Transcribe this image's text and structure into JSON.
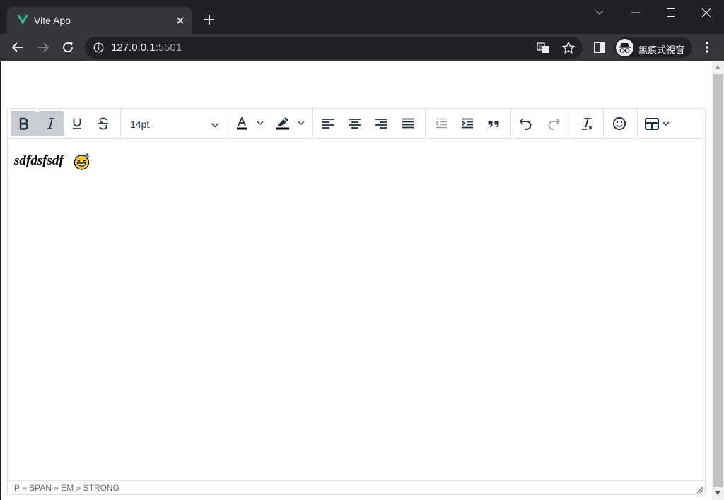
{
  "browser": {
    "tab_title": "Vite App",
    "url_host": "127.0.0.1",
    "url_port": ":5501",
    "incognito_label": "無痕式視窗"
  },
  "editor": {
    "toolbar": {
      "font_size": "14pt",
      "active_buttons": [
        "bold",
        "italic"
      ]
    },
    "content_text": "sdfdsfsdf",
    "emoji": "grinning-face-with-sweat",
    "status_path": "P » SPAN » EM » STRONG"
  },
  "colors": {
    "chrome_dark": "#202124",
    "chrome_tab": "#35363a",
    "vue_green": "#41b883",
    "active_button": "#c9cdd3",
    "editor_icon": "#222f3e"
  }
}
